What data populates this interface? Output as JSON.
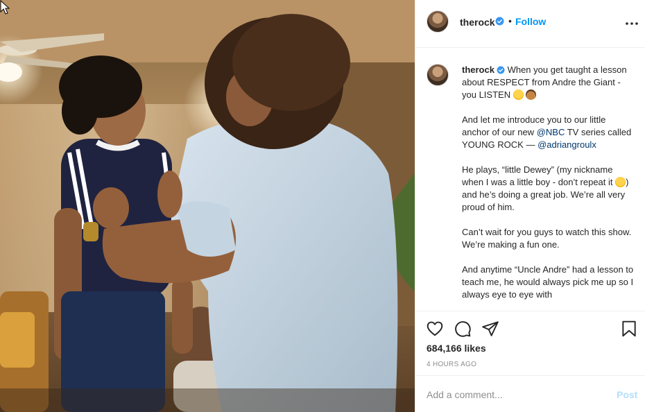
{
  "post": {
    "image_alt": "Scene from YOUNG ROCK: a large curly-haired man in a light blue shirt holds up a young boy in a navy striped shirt",
    "icons": {
      "verified": "verified-badge-icon",
      "more": "more-options-icon",
      "like": "heart-icon",
      "comment": "comment-icon",
      "share": "paper-plane-icon",
      "save": "bookmark-icon",
      "cursor": "mouse-cursor-icon"
    },
    "colors": {
      "accent": "#0095f6",
      "verified": "#3897f0",
      "post_disabled": "#b2dffc",
      "mention": "#00376b",
      "muted": "#8e8e8e"
    }
  },
  "header": {
    "username": "therock",
    "separator": "•",
    "follow_label": "Follow"
  },
  "caption": {
    "username": "therock",
    "p1_text": " When you get taught a lesson about RESPECT from Andre the Giant - you LISTEN ",
    "p2_text": "And let me introduce you to our little anchor of our new ",
    "p2_mention1": "@NBC",
    "p2_text2": " TV series called YOUNG ROCK — ",
    "p2_mention2": "@adriangroulx",
    "p3_text": "He plays, “little Dewey” (my nickname when I was a little boy - don’t repeat it ",
    "p3_text2": ") and he’s doing a great job. We’re all very proud of him.",
    "p4_text": "Can’t wait for you guys to watch this show. We’re making a fun one.",
    "p5_text": "And anytime “Uncle Andre” had a lesson to teach me, he would always pick me up so I always eye to eye with"
  },
  "actions": {
    "likes": "684,166 likes",
    "timestamp": "4 HOURS AGO"
  },
  "comment": {
    "placeholder": "Add a comment...",
    "post_label": "Post"
  }
}
